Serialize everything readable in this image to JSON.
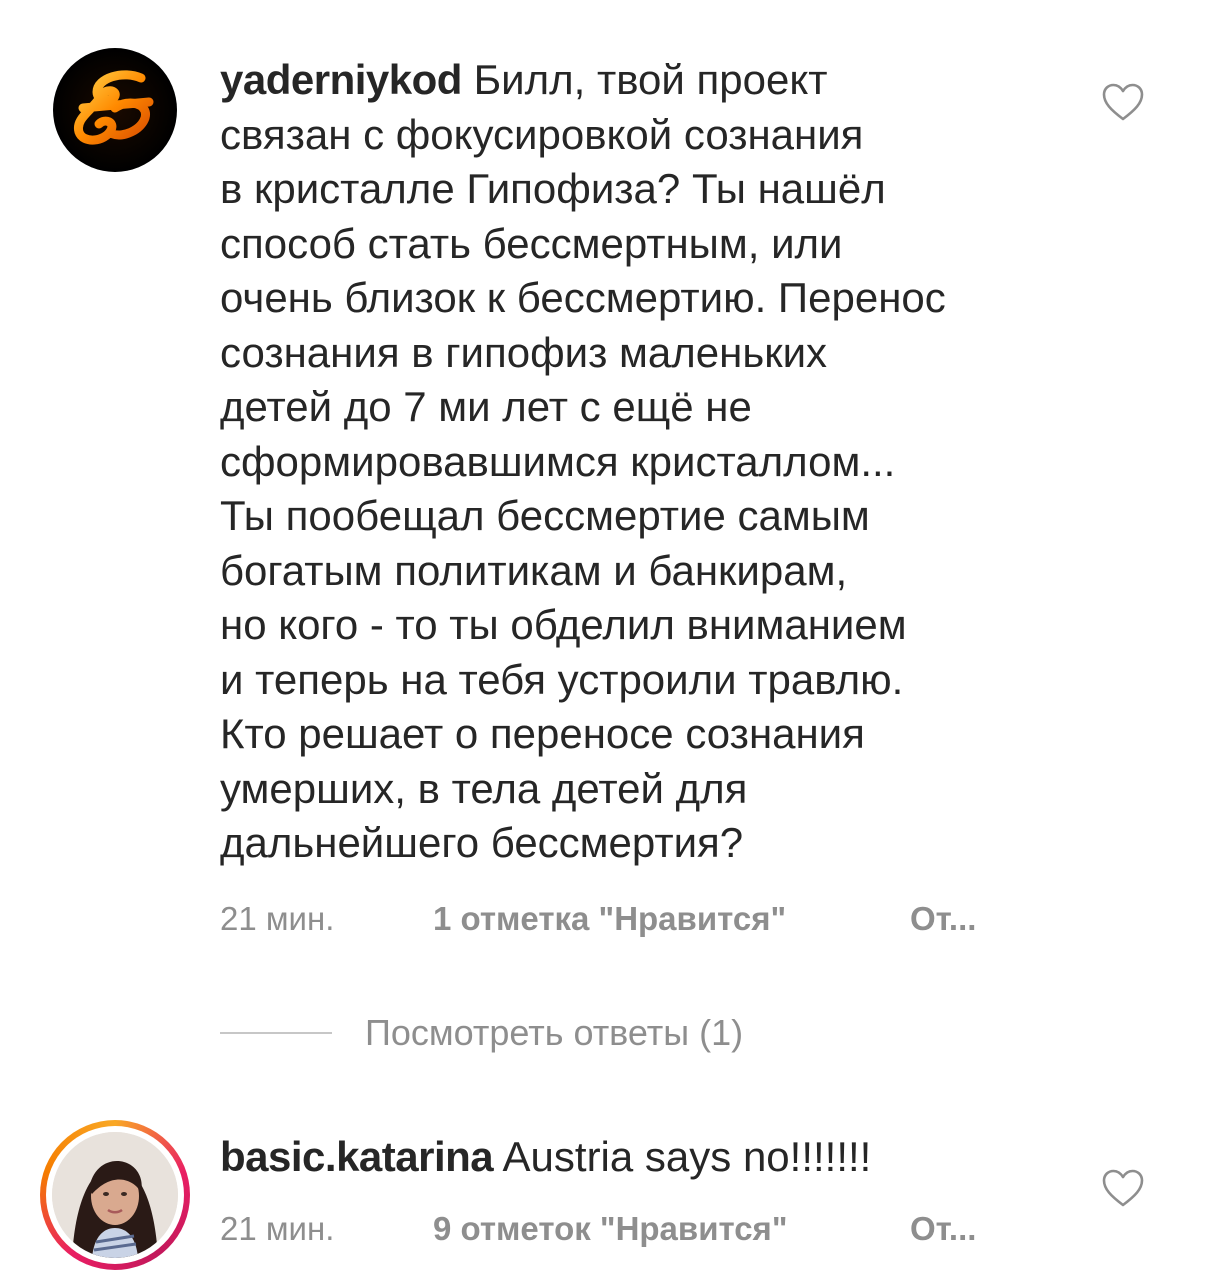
{
  "comments": [
    {
      "username": "yaderniykod",
      "lines": [
        "Билл, твой проект",
        "связан с фокусировкой сознания",
        "в кристалле Гипофиза? Ты нашёл",
        "способ стать бессмертным, или",
        "очень близок к бессмертию. Перенос",
        "сознания в гипофиз маленьких",
        "детей до 7 ми лет с ещё не",
        "сформировавшимся кристаллом...",
        "Ты пообещал бессмертие самым",
        "богатым политикам и банкирам,",
        "но кого - то ты обделил вниманием",
        "и теперь на тебя устроили травлю.",
        "Кто решает о переносе сознания",
        "умерших, в тела детей для",
        "дальнейшего бессмертия?"
      ],
      "time": "21 мин.",
      "likes": "1 отметка \"Нравится\"",
      "reply": "От...",
      "view_replies": "Посмотреть ответы (1)",
      "avatar_icon": "orange-script-monogram"
    },
    {
      "username": "basic.katarina",
      "text": "Austria says no!!!!!!!",
      "time": "21 мин.",
      "likes": "9 отметок \"Нравится\"",
      "reply": "От...",
      "avatar_icon": "profile-photo-woman",
      "story_ring": true
    }
  ],
  "colors": {
    "text": "#262626",
    "secondary": "#8e8e8e",
    "divider": "#c7c7c7",
    "background": "#ffffff"
  }
}
